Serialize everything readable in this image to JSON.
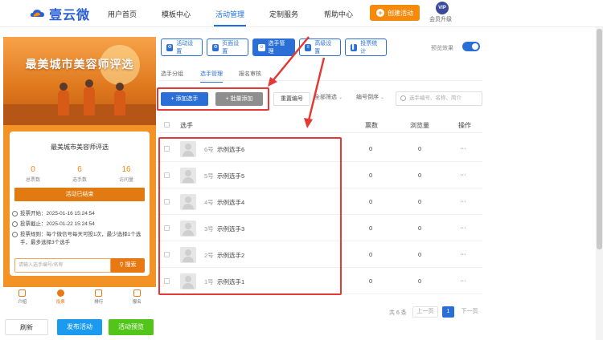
{
  "app": {
    "logo_text": "壹云微"
  },
  "nav": [
    {
      "label": "用户首页"
    },
    {
      "label": "模板中心"
    },
    {
      "label": "活动管理"
    },
    {
      "label": "定制服务"
    },
    {
      "label": "帮助中心"
    }
  ],
  "create_button": "创建活动",
  "vip": {
    "badge": "VIP",
    "label": "会员升级"
  },
  "phone": {
    "banner_title": "最美城市美容师评选",
    "card_title": "最美城市美容师评选",
    "stats": [
      {
        "value": "0",
        "label": "总票数"
      },
      {
        "value": "6",
        "label": "选手数"
      },
      {
        "value": "16",
        "label": "访问量"
      }
    ],
    "ended_label": "活动已结束",
    "vote_start": "投票开始：2025-01-16 15:24:54",
    "vote_end": "投票截止：2025-01-22 15:24:54",
    "vote_rule_1": "投票规则：每个微信号每天可投1次，最少选择1个选",
    "vote_rule_2": "手，最多选择3个选手",
    "search_placeholder": "请输入选手编号/名称",
    "search_button": "搜索",
    "tabbar": [
      {
        "label": "介绍"
      },
      {
        "label": "投票"
      },
      {
        "label": "排行"
      },
      {
        "label": "报名"
      }
    ]
  },
  "bottom_buttons": {
    "refresh": "刷新",
    "publish": "发布活动",
    "preview": "活动预览"
  },
  "toolbar": [
    {
      "label": "活动设置"
    },
    {
      "label": "页面设置"
    },
    {
      "label": "选手管理"
    },
    {
      "label": "高级设置"
    },
    {
      "label": "投票统计"
    }
  ],
  "preview_effect": "预览效果",
  "subtabs": [
    {
      "label": "选手分组"
    },
    {
      "label": "选手管理"
    },
    {
      "label": "报名审核"
    }
  ],
  "actions": {
    "add_player": "+ 添加选手",
    "batch_add": "+ 批量添加",
    "reset_numbers": "重置编号",
    "filter_all": "全部筛选",
    "sort_desc": "编号倒序",
    "search_placeholder": "选手编号、名称、简介"
  },
  "table": {
    "headers": {
      "player": "选手",
      "votes": "票数",
      "views": "浏览量",
      "ops": "操作"
    },
    "rows": [
      {
        "num": "6号",
        "name": "示例选手6",
        "votes": "0",
        "views": "0",
        "ops": "···"
      },
      {
        "num": "5号",
        "name": "示例选手5",
        "votes": "0",
        "views": "0",
        "ops": "···"
      },
      {
        "num": "4号",
        "name": "示例选手4",
        "votes": "0",
        "views": "0",
        "ops": "···"
      },
      {
        "num": "3号",
        "name": "示例选手3",
        "votes": "0",
        "views": "0",
        "ops": "···"
      },
      {
        "num": "2号",
        "name": "示例选手2",
        "votes": "0",
        "views": "0",
        "ops": "···"
      },
      {
        "num": "1号",
        "name": "示例选手1",
        "votes": "0",
        "views": "0",
        "ops": "···"
      }
    ]
  },
  "pagination": {
    "total": "共 6 条",
    "prev": "上一页",
    "current": "1",
    "next": "下一页"
  },
  "colors": {
    "accent": "#2b6fd6",
    "orange": "#f58a0c",
    "green": "#52c41a",
    "highlight": "#e53935"
  }
}
